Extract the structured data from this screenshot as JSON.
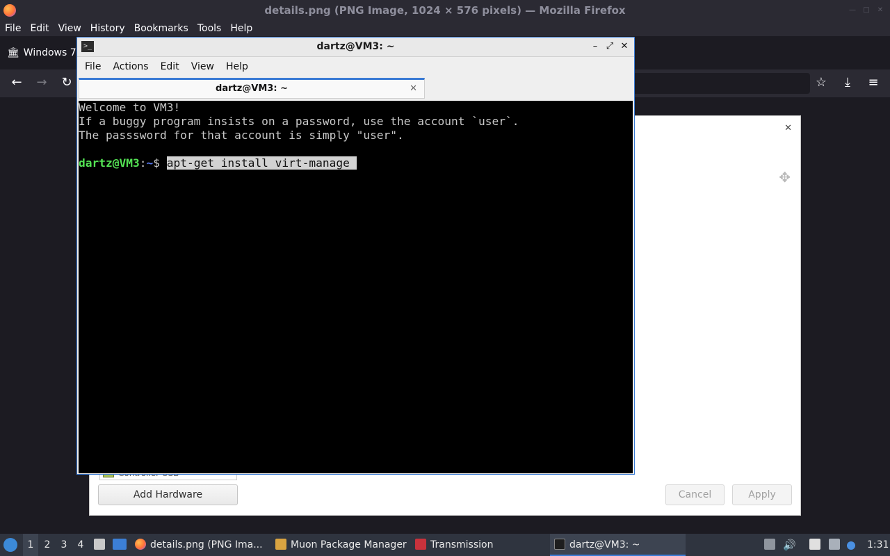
{
  "firefox": {
    "window_title": "details.png (PNG Image, 1024 × 576 pixels) — Mozilla Firefox",
    "menu": [
      "File",
      "Edit",
      "View",
      "History",
      "Bookmarks",
      "Tools",
      "Help"
    ],
    "tab_label": "Windows 7"
  },
  "dialog": {
    "list_item_partial": "Controller USB",
    "add_hardware": "Add Hardware",
    "cancel": "Cancel",
    "apply": "Apply"
  },
  "terminal": {
    "window_title": "dartz@VM3: ~",
    "menu": [
      "File",
      "Actions",
      "Edit",
      "View",
      "Help"
    ],
    "tab_title": "dartz@VM3: ~",
    "lines": [
      "Welcome to VM3!",
      "If a buggy program insists on a password, use the account `user`.",
      "The passsword for that account is simply \"user\"."
    ],
    "prompt_user": "dartz@VM3",
    "prompt_sep": ":",
    "prompt_path": "~",
    "prompt_sign": "$ ",
    "command": "apt-get install virt-manage"
  },
  "taskbar": {
    "workspaces": [
      "1",
      "2",
      "3",
      "4"
    ],
    "tasks": [
      "details.png (PNG Ima...",
      "Muon Package Manager",
      "Transmission",
      "dartz@VM3: ~"
    ],
    "clock": "1:31"
  },
  "colors": {
    "accent": "#3a7bd5",
    "prompt_user": "#54e354",
    "prompt_path": "#5a7cf5",
    "taskbar_bg": "#2f343f"
  }
}
